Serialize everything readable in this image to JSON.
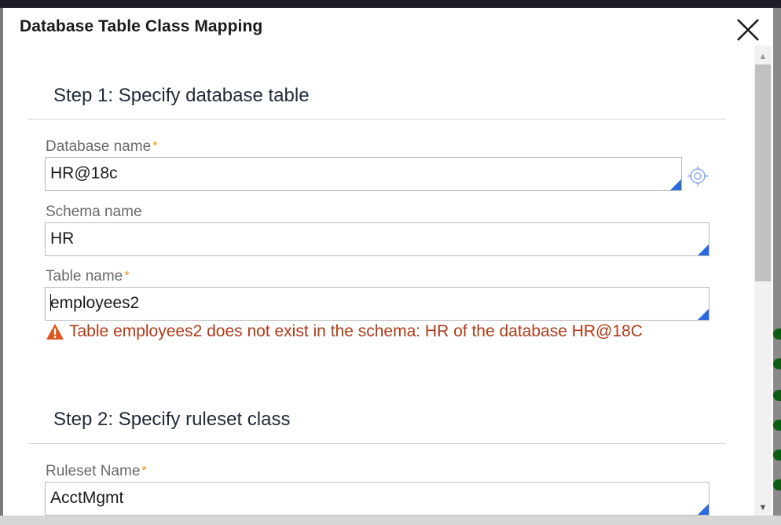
{
  "modal": {
    "title": "Database Table Class Mapping"
  },
  "step1": {
    "heading": "Step 1: Specify database table",
    "database": {
      "label": "Database name",
      "required_mark": "*",
      "value": "HR@18c"
    },
    "schema": {
      "label": "Schema name",
      "value": "HR"
    },
    "table": {
      "label": "Table name",
      "required_mark": "*",
      "value": "employees2"
    },
    "error": "Table employees2 does not exist in the schema: HR of the database HR@18C"
  },
  "step2": {
    "heading": "Step 2: Specify ruleset class",
    "ruleset": {
      "label": "Ruleset Name",
      "required_mark": "*",
      "value": "AcctMgmt"
    }
  },
  "colors": {
    "accent": "#2a6ae0",
    "required": "#e39a1e",
    "error": "#b13a16"
  },
  "icons": [
    "close-icon",
    "target-icon",
    "warning-icon",
    "scroll-up-icon",
    "scroll-down-icon"
  ]
}
